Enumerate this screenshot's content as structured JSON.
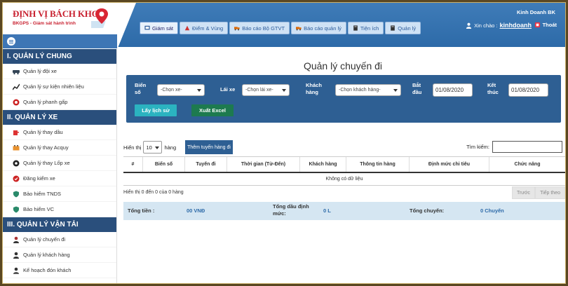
{
  "brand": {
    "title": "ĐỊNH VỊ BÁCH KHOA",
    "subtitle": "BKGPS - Giám sát hành trình"
  },
  "header": {
    "company": "Kinh Doanh BK",
    "greeting": "Xin chào :",
    "username": "kinhdoanh",
    "logout": "Thoát"
  },
  "tabs": [
    {
      "label": "Giám sát",
      "icon": "monitor-icon"
    },
    {
      "label": "Điểm & Vùng",
      "icon": "route-icon"
    },
    {
      "label": "Báo cáo Bộ GTVT",
      "icon": "truck-icon"
    },
    {
      "label": "Báo cáo quản lý",
      "icon": "truck-icon"
    },
    {
      "label": "Tiện ích",
      "icon": "book-icon"
    },
    {
      "label": "Quản lý",
      "icon": "book-icon"
    }
  ],
  "sidebar": {
    "sections": [
      {
        "title": "I. QUẢN LÝ CHUNG",
        "items": [
          "Quản lý đội xe",
          "Quản lý sự kiện nhiên liệu",
          "Quản lý phanh gấp"
        ]
      },
      {
        "title": "II. QUẢN LÝ XE",
        "items": [
          "Quản lý thay dầu",
          "Quản lý thay Acquy",
          "Quản lý thay Lốp xe",
          "Đăng kiểm xe",
          "Bảo hiểm TNDS",
          "Bảo hiểm VC"
        ]
      },
      {
        "title": "III. QUẢN LÝ VẬN TẢI",
        "items": [
          "Quản lý chuyến đi",
          "Quản lý khách hàng",
          "Kế hoạch đón khách"
        ]
      }
    ]
  },
  "page": {
    "title": "Quản lý chuyến đi"
  },
  "filter": {
    "vehicle_label": "Biển số",
    "vehicle_placeholder": "-Chọn xe-",
    "driver_label": "Lái xe",
    "driver_placeholder": "-Chọn lái xe-",
    "customer_label": "Khách hàng",
    "customer_placeholder": "-Chọn khách hàng-",
    "start_label": "Bắt đầu",
    "start_value": "01/08/2020",
    "end_label": "Kết thúc",
    "end_value": "01/08/2020",
    "history_button": "Lấy lịch sử",
    "excel_button": "Xuất Excel"
  },
  "list": {
    "show_label": "Hiển thị",
    "page_size": "10",
    "rows_label": "hàng",
    "add_button": "Thêm tuyến hàng đi",
    "search_label": "Tìm kiếm:",
    "search_value": ""
  },
  "table": {
    "columns": [
      "#",
      "Biển số",
      "Tuyến đi",
      "Thời gian (Từ-Đến)",
      "Khách hàng",
      "Thông tin hàng",
      "Định mức chi tiêu",
      "Chức năng"
    ],
    "empty_text": "Không có dữ liệu",
    "info_text": "Hiển thị 0 đến 0 của 0 hàng",
    "prev": "Trước",
    "next": "Tiếp theo"
  },
  "summary": {
    "total_money_label": "Tổng tiền :",
    "total_money_value": "00 VNĐ",
    "oil_label": "Tổng dầu định mức:",
    "oil_value": "0 L",
    "trips_label": "Tổng chuyến:",
    "trips_value": "0 Chuyến"
  },
  "colors": {
    "primary": "#2e5f93",
    "header": "#3f7cb8",
    "sidebar_section": "#2a4f7c",
    "brand_red": "#c8202f"
  }
}
